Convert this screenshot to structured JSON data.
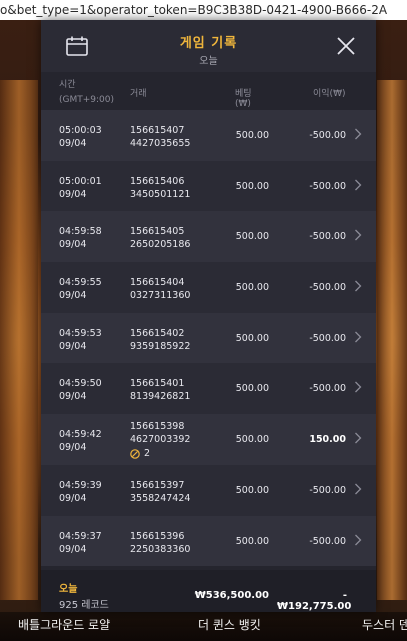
{
  "browser": {
    "url_text": "o&bet_type=1&operator_token=B9C3B38D-0421-4900-B666-2A"
  },
  "header": {
    "title": "게임 기록",
    "subtitle": "오늘",
    "calendar_icon": "calendar-icon",
    "close_icon": "close-icon"
  },
  "columns": {
    "time_line1": "시간",
    "time_line2": "(GMT+9:00)",
    "transaction": "거래",
    "bet": "베팅(₩)",
    "profit": "이익(₩)"
  },
  "rows": [
    {
      "time": "05:00:03",
      "date": "09/04",
      "id1": "156615407",
      "id2": "4427035655",
      "bet": "500.00",
      "profit": "-500.00"
    },
    {
      "time": "05:00:01",
      "date": "09/04",
      "id1": "156615406",
      "id2": "3450501121",
      "bet": "500.00",
      "profit": "-500.00"
    },
    {
      "time": "04:59:58",
      "date": "09/04",
      "id1": "156615405",
      "id2": "2650205186",
      "bet": "500.00",
      "profit": "-500.00"
    },
    {
      "time": "04:59:55",
      "date": "09/04",
      "id1": "156615404",
      "id2": "0327311360",
      "bet": "500.00",
      "profit": "-500.00"
    },
    {
      "time": "04:59:53",
      "date": "09/04",
      "id1": "156615402",
      "id2": "9359185922",
      "bet": "500.00",
      "profit": "-500.00"
    },
    {
      "time": "04:59:50",
      "date": "09/04",
      "id1": "156615401",
      "id2": "8139426821",
      "bet": "500.00",
      "profit": "-500.00"
    },
    {
      "time": "04:59:42",
      "date": "09/04",
      "id1": "156615398",
      "id2": "4627003392",
      "bet": "500.00",
      "profit": "150.00",
      "badge": "2"
    },
    {
      "time": "04:59:39",
      "date": "09/04",
      "id1": "156615397",
      "id2": "3558247424",
      "bet": "500.00",
      "profit": "-500.00"
    },
    {
      "time": "04:59:37",
      "date": "09/04",
      "id1": "156615396",
      "id2": "2250383360",
      "bet": "500.00",
      "profit": "-500.00"
    }
  ],
  "footer": {
    "label": "오늘",
    "count": "925 레코드",
    "total_bet": "₩536,500.00",
    "total_profit": "-₩192,775.00"
  },
  "background_games": {
    "left": "배틀그라운드 로얄",
    "center": "더 퀸스 뱅킷",
    "right": "두스터 덴"
  },
  "colors": {
    "accent": "#f0b63c",
    "panel": "#25252e",
    "row_odd": "#32323d",
    "row_even": "#2b2b35"
  }
}
